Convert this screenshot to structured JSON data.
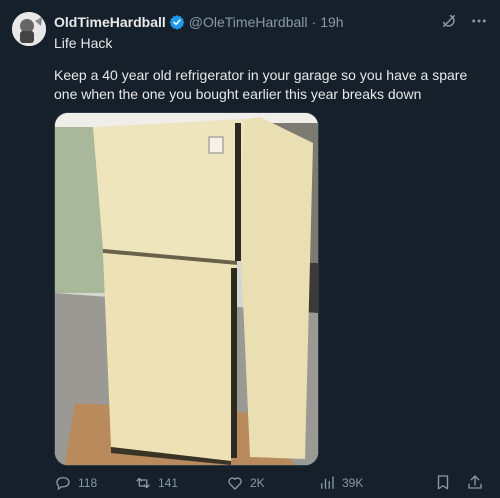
{
  "tweet": {
    "author": {
      "display_name": "OldTimeHardball",
      "handle": "@OleTimeHardball",
      "timestamp": "19h",
      "verified": true
    },
    "subtitle": "Life Hack",
    "text": "Keep a 40 year old refrigerator in your garage so you have a spare one when the one you bought earlier this year breaks down",
    "media": {
      "description_icon": "photo-refrigerator"
    },
    "actions": {
      "reply_count": "118",
      "retweet_count": "141",
      "like_count": "2K",
      "views_count": "39K"
    }
  },
  "colors": {
    "background": "#15202b",
    "text": "#e7e9ea",
    "muted": "#8b98a5",
    "verified": "#1d9bf0"
  },
  "icons": {
    "top_right": [
      "grok-icon",
      "more-icon"
    ],
    "actions": [
      "reply-icon",
      "retweet-icon",
      "like-icon",
      "views-icon",
      "bookmark-icon",
      "share-icon"
    ]
  }
}
